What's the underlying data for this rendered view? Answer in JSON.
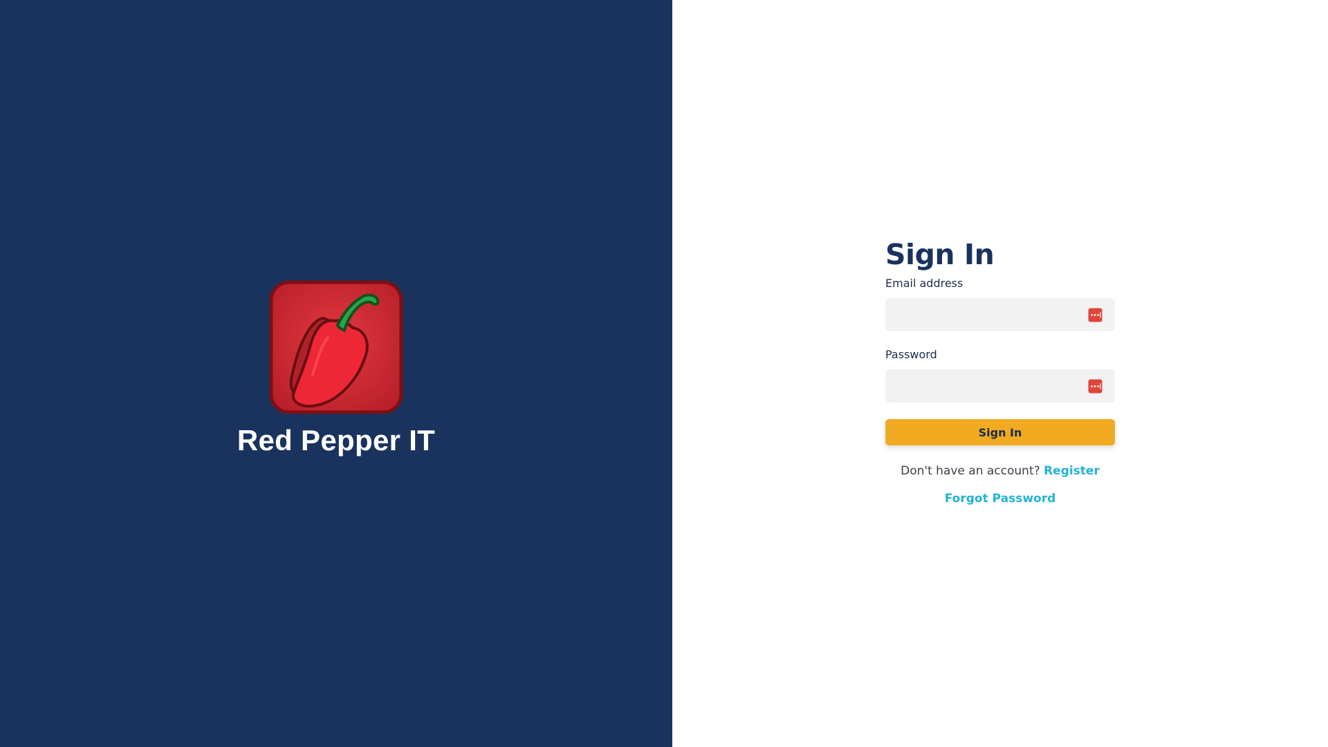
{
  "brand": {
    "name": "Red Pepper IT",
    "logo_icon": "red-pepper-icon"
  },
  "colors": {
    "left_panel_bg": "#19335e",
    "right_panel_bg": "#ffffff",
    "title": "#19335e",
    "input_bg": "#f3f2f2",
    "button_bg": "#f0ab22",
    "link": "#22b3d6",
    "password_manager_icon": "#e0453a"
  },
  "form": {
    "title": "Sign In",
    "email": {
      "label": "Email address",
      "value": "",
      "icon": "password-manager-icon"
    },
    "password": {
      "label": "Password",
      "value": "",
      "icon": "password-manager-icon"
    },
    "submit_label": "Sign In",
    "register_prompt": "Don't have an account?",
    "register_link": "Register",
    "forgot_link": "Forgot Password"
  }
}
